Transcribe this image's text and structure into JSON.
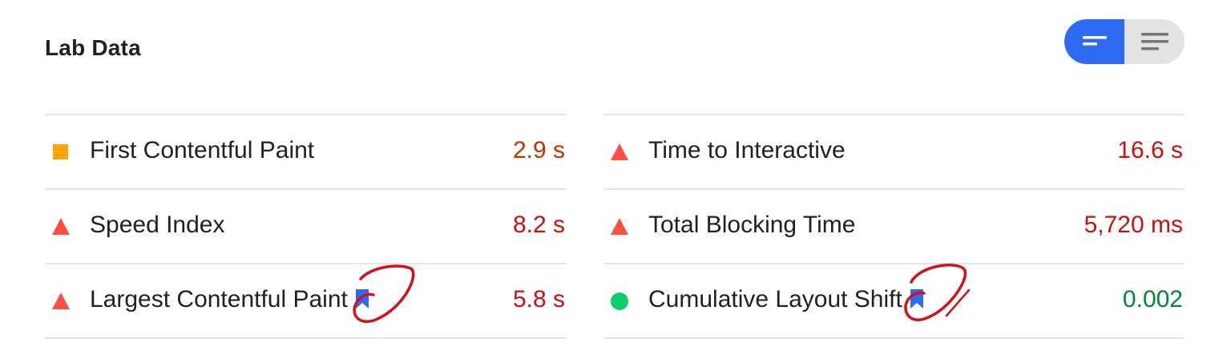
{
  "section": {
    "title": "Lab Data"
  },
  "view_toggle": {
    "options": [
      "list-summary-view",
      "list-detail-view"
    ],
    "selected": "list-summary-view",
    "active_color": "#2f6af2"
  },
  "status_colors": {
    "average": "#ffa400",
    "fail": "#ff4e42",
    "pass": "#0cce6b",
    "average_text": "#c33300",
    "fail_text": "#cc0f0f",
    "pass_text": "#018642"
  },
  "metrics": {
    "left": [
      {
        "label": "First Contentful Paint",
        "value": "2.9 s",
        "status": "average",
        "icon": "orange-square-icon",
        "bookmark": false
      },
      {
        "label": "Speed Index",
        "value": "8.2 s",
        "status": "fail",
        "icon": "red-triangle-icon",
        "bookmark": false
      },
      {
        "label": "Largest Contentful Paint",
        "value": "5.8 s",
        "status": "fail",
        "icon": "red-triangle-icon",
        "bookmark": true
      }
    ],
    "right": [
      {
        "label": "Time to Interactive",
        "value": "16.6 s",
        "status": "fail",
        "icon": "red-triangle-icon",
        "bookmark": false
      },
      {
        "label": "Total Blocking Time",
        "value": "5,720 ms",
        "status": "fail",
        "icon": "red-triangle-icon",
        "bookmark": false
      },
      {
        "label": "Cumulative Layout Shift",
        "value": "0.002",
        "status": "pass",
        "icon": "green-circle-icon",
        "bookmark": true
      }
    ]
  },
  "annotations": {
    "circle_color": "#d4111b"
  }
}
